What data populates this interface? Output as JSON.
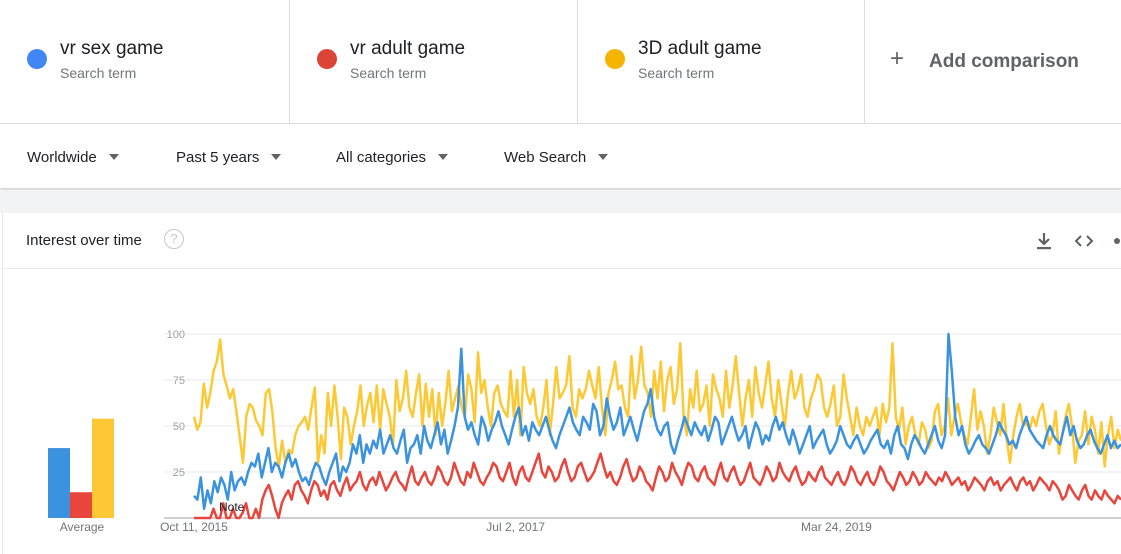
{
  "terms": [
    {
      "name": "vr sex game",
      "sub": "Search term",
      "color": "#4285f4"
    },
    {
      "name": "vr adult game",
      "sub": "Search term",
      "color": "#db4437"
    },
    {
      "name": "3D adult game",
      "sub": "Search term",
      "color": "#f4b400"
    }
  ],
  "add_comparison": {
    "icon": "plus-icon",
    "label": "Add comparison"
  },
  "filters": [
    {
      "label": "Worldwide"
    },
    {
      "label": "Past 5 years"
    },
    {
      "label": "All categories"
    },
    {
      "label": "Web Search"
    }
  ],
  "card": {
    "title": "Interest over time",
    "help_icon": "?",
    "tools": [
      "download-icon",
      "embed-icon",
      "share-icon"
    ]
  },
  "chart_data": {
    "type": "line",
    "y_ticks": [
      "25",
      "50",
      "75",
      "100"
    ],
    "ylim": [
      0,
      100
    ],
    "x_labels": [
      {
        "label": "Oct 11, 2015",
        "t": 0
      },
      {
        "label": "Jul 2, 2017",
        "t": 0.347
      },
      {
        "label": "Mar 24, 2019",
        "t": 0.693
      }
    ],
    "note_label": "Note",
    "average_label": "Average",
    "averages": [
      {
        "name": "vr sex game",
        "value": 38,
        "color": "#3b93e0"
      },
      {
        "name": "vr adult game",
        "value": 14,
        "color": "#e8453c"
      },
      {
        "name": "3D adult game",
        "value": 54,
        "color": "#fcc934"
      }
    ],
    "series": [
      {
        "name": "3D adult game",
        "color": "#fcc934",
        "values": [
          55,
          48,
          52,
          73,
          60,
          68,
          80,
          85,
          97,
          78,
          72,
          65,
          70,
          58,
          44,
          30,
          55,
          62,
          60,
          53,
          50,
          45,
          68,
          70,
          58,
          38,
          28,
          42,
          30,
          37,
          35,
          45,
          50,
          52,
          55,
          48,
          60,
          71,
          30,
          45,
          35,
          68,
          50,
          72,
          55,
          32,
          60,
          55,
          40,
          50,
          58,
          72,
          50,
          61,
          68,
          52,
          72,
          48,
          70,
          62,
          55,
          40,
          75,
          58,
          65,
          80,
          60,
          55,
          68,
          78,
          50,
          73,
          55,
          70,
          45,
          68,
          50,
          62,
          80,
          58,
          65,
          72,
          60,
          55,
          78,
          70,
          52,
          90,
          68,
          75,
          60,
          50,
          68,
          72,
          62,
          58,
          55,
          80,
          55,
          75,
          45,
          82,
          68,
          62,
          70,
          55,
          50,
          60,
          75,
          45,
          62,
          82,
          65,
          68,
          72,
          88,
          60,
          55,
          70,
          65,
          70,
          80,
          72,
          65,
          82,
          60,
          45,
          68,
          75,
          85,
          70,
          72,
          60,
          55,
          88,
          65,
          75,
          93,
          72,
          68,
          55,
          80,
          65,
          85,
          58,
          75,
          82,
          62,
          70,
          95,
          55,
          45,
          70,
          60,
          80,
          58,
          62,
          72,
          50,
          78,
          70,
          65,
          55,
          80,
          60,
          72,
          88,
          68,
          50,
          65,
          75,
          55,
          82,
          68,
          60,
          72,
          85,
          65,
          55,
          75,
          62,
          50,
          68,
          80,
          65,
          70,
          78,
          60,
          55,
          65,
          70,
          78,
          75,
          60,
          55,
          62,
          72,
          50,
          55,
          78,
          65,
          55,
          45,
          60,
          50,
          45,
          55,
          50,
          55,
          60,
          45,
          62,
          52,
          60,
          95,
          55,
          48,
          60,
          40,
          50,
          55,
          45,
          40,
          52,
          48,
          38,
          42,
          58,
          62,
          45,
          50,
          65,
          45,
          55,
          62,
          52,
          45,
          40,
          55,
          70,
          48,
          58,
          50,
          35,
          45,
          60,
          52,
          45,
          62,
          42,
          30,
          45,
          55,
          62,
          50,
          52,
          48,
          55,
          50,
          58,
          62,
          50,
          40,
          45,
          58,
          35,
          45,
          55,
          62,
          50,
          30,
          42,
          45,
          58,
          40,
          55,
          48,
          35,
          52,
          28,
          45,
          55,
          38,
          48,
          42
        ]
      },
      {
        "name": "vr sex game",
        "color": "#3b93e0",
        "values": [
          12,
          10,
          22,
          5,
          15,
          8,
          20,
          14,
          22,
          18,
          10,
          25,
          15,
          20,
          22,
          18,
          25,
          30,
          28,
          35,
          22,
          30,
          38,
          25,
          30,
          28,
          22,
          30,
          35,
          28,
          32,
          25,
          20,
          22,
          18,
          25,
          30,
          28,
          22,
          18,
          25,
          30,
          35,
          20,
          28,
          25,
          30,
          40,
          35,
          45,
          30,
          40,
          35,
          42,
          38,
          48,
          35,
          40,
          45,
          38,
          35,
          42,
          48,
          30,
          38,
          40,
          45,
          35,
          50,
          42,
          38,
          45,
          52,
          40,
          48,
          35,
          42,
          50,
          60,
          92,
          55,
          48,
          52,
          45,
          40,
          55,
          50,
          42,
          48,
          52,
          58,
          50,
          45,
          40,
          48,
          55,
          60,
          45,
          50,
          42,
          52,
          48,
          45,
          50,
          55,
          48,
          42,
          38,
          45,
          50,
          55,
          60,
          52,
          48,
          45,
          55,
          52,
          48,
          62,
          58,
          45,
          50,
          65,
          55,
          48,
          52,
          60,
          45,
          50,
          55,
          48,
          42,
          50,
          58,
          62,
          70,
          55,
          48,
          45,
          50,
          52,
          40,
          35,
          42,
          48,
          55,
          50,
          45,
          52,
          48,
          45,
          50,
          42,
          48,
          55,
          52,
          40,
          45,
          50,
          55,
          48,
          42,
          45,
          50,
          38,
          45,
          52,
          48,
          40,
          45,
          42,
          50,
          55,
          48,
          52,
          45,
          40,
          48,
          42,
          35,
          40,
          45,
          50,
          38,
          42,
          45,
          48,
          40,
          35,
          38,
          42,
          50,
          45,
          40,
          38,
          42,
          45,
          40,
          35,
          38,
          42,
          45,
          48,
          40,
          38,
          42,
          35,
          45,
          50,
          40,
          38,
          32,
          40,
          45,
          42,
          38,
          35,
          40,
          45,
          50,
          42,
          38,
          45,
          100,
          80,
          55,
          45,
          50,
          40,
          35,
          38,
          42,
          45,
          40,
          38,
          35,
          40,
          45,
          52,
          48,
          45,
          40,
          42,
          38,
          45,
          50,
          55,
          48,
          45,
          42,
          40,
          38,
          45,
          50,
          45,
          42,
          40,
          48,
          55,
          45,
          50,
          42,
          38,
          40,
          45,
          48,
          42,
          38,
          35,
          40,
          45,
          38,
          42,
          38,
          40
        ]
      },
      {
        "name": "vr adult game",
        "color": "#e8453c",
        "values": [
          0,
          0,
          0,
          0,
          0,
          0,
          5,
          0,
          0,
          8,
          0,
          0,
          5,
          0,
          0,
          3,
          8,
          0,
          0,
          5,
          0,
          10,
          15,
          18,
          12,
          5,
          0,
          8,
          12,
          15,
          10,
          18,
          20,
          15,
          12,
          8,
          15,
          20,
          18,
          12,
          15,
          10,
          18,
          20,
          15,
          12,
          18,
          22,
          15,
          18,
          20,
          25,
          18,
          15,
          20,
          22,
          18,
          25,
          20,
          15,
          18,
          22,
          25,
          20,
          18,
          15,
          22,
          28,
          20,
          18,
          22,
          25,
          20,
          18,
          22,
          28,
          25,
          20,
          18,
          22,
          30,
          25,
          20,
          18,
          25,
          22,
          30,
          25,
          20,
          18,
          22,
          25,
          30,
          28,
          22,
          20,
          25,
          30,
          22,
          18,
          25,
          28,
          22,
          20,
          25,
          30,
          35,
          25,
          22,
          28,
          25,
          20,
          22,
          28,
          32,
          25,
          20,
          22,
          28,
          30,
          25,
          20,
          22,
          25,
          30,
          35,
          28,
          22,
          25,
          20,
          18,
          22,
          28,
          32,
          25,
          20,
          22,
          28,
          25,
          20,
          18,
          15,
          22,
          28,
          25,
          20,
          22,
          30,
          25,
          22,
          18,
          25,
          30,
          28,
          22,
          20,
          25,
          28,
          22,
          20,
          18,
          25,
          30,
          22,
          20,
          25,
          28,
          22,
          18,
          20,
          25,
          30,
          22,
          20,
          18,
          22,
          28,
          25,
          20,
          22,
          30,
          25,
          22,
          20,
          25,
          28,
          22,
          18,
          20,
          25,
          22,
          20,
          25,
          28,
          22,
          20,
          18,
          22,
          25,
          20,
          18,
          22,
          28,
          25,
          20,
          18,
          22,
          25,
          20,
          18,
          22,
          28,
          25,
          20,
          18,
          15,
          20,
          25,
          22,
          18,
          20,
          25,
          22,
          18,
          20,
          25,
          22,
          20,
          18,
          22,
          20,
          25,
          22,
          18,
          20,
          22,
          18,
          20,
          15,
          18,
          22,
          20,
          18,
          15,
          20,
          22,
          18,
          20,
          15,
          18,
          20,
          22,
          18,
          15,
          20,
          22,
          18,
          20,
          15,
          18,
          22,
          20,
          18,
          15,
          20,
          18,
          15,
          10,
          12,
          18,
          15,
          12,
          10,
          15,
          18,
          12,
          10,
          15,
          12,
          10,
          15,
          12,
          10,
          8,
          12,
          10
        ]
      }
    ]
  }
}
